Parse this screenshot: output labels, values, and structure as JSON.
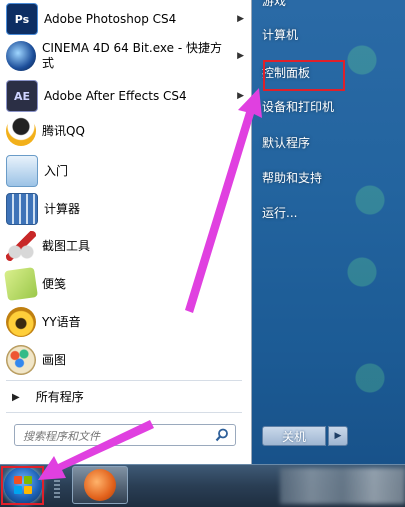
{
  "start_menu": {
    "programs": [
      {
        "label": "Adobe Photoshop CS4",
        "icon": "photoshop-icon",
        "has_submenu": true
      },
      {
        "label": "CINEMA 4D 64 Bit.exe - 快捷方式",
        "icon": "cinema4d-icon",
        "has_submenu": true
      },
      {
        "label": "Adobe After Effects CS4",
        "icon": "after-effects-icon",
        "has_submenu": true
      },
      {
        "label": "腾讯QQ",
        "icon": "qq-penguin-icon",
        "has_submenu": false
      },
      {
        "label": "入门",
        "icon": "getting-started-icon",
        "has_submenu": false
      },
      {
        "label": "计算器",
        "icon": "calculator-icon",
        "has_submenu": false
      },
      {
        "label": "截图工具",
        "icon": "snipping-tool-icon",
        "has_submenu": false
      },
      {
        "label": "便笺",
        "icon": "sticky-notes-icon",
        "has_submenu": false
      },
      {
        "label": "YY语音",
        "icon": "yy-voice-icon",
        "has_submenu": false
      },
      {
        "label": "画图",
        "icon": "paint-icon",
        "has_submenu": false
      }
    ],
    "all_programs": "所有程序",
    "search_placeholder": "搜索程序和文件",
    "right_items": {
      "games": "游戏",
      "computer": "计算机",
      "control_panel": "控制面板",
      "devices_printers": "设备和打印机",
      "default_programs": "默认程序",
      "help_support": "帮助和支持",
      "run": "运行..."
    },
    "shutdown_label": "关机"
  },
  "colors": {
    "highlight": "#e0202a",
    "arrow": "#e040e0"
  }
}
